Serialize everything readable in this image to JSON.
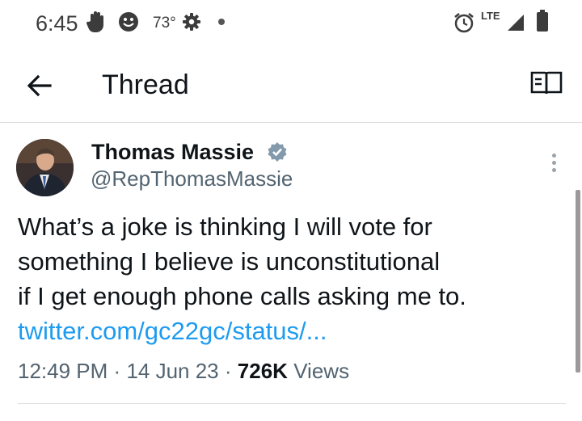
{
  "status_bar": {
    "time": "6:45",
    "temperature": "73°",
    "network": "LTE",
    "icons": [
      "hand-icon",
      "smiley-icon",
      "gear-icon",
      "dot-icon",
      "alarm-icon",
      "signal-icon",
      "battery-icon"
    ]
  },
  "app_bar": {
    "title": "Thread",
    "back_icon": "arrow-left-icon",
    "reader_icon": "book-icon"
  },
  "tweet": {
    "author_name": "Thomas Massie",
    "handle": "@RepThomasMassie",
    "verified": true,
    "text_lines": [
      "What’s a joke is thinking I will vote for",
      "something I believe is unconstitutional",
      "if I get enough phone calls asking me to."
    ],
    "link": "twitter.com/gc22gc/status/...",
    "time": "12:49 PM",
    "separator": "·",
    "date": "14 Jun 23",
    "views_count": "726K",
    "views_label": "Views"
  },
  "colors": {
    "link": "#1d9bf0",
    "secondary_text": "#536471",
    "verified_badge": "#829aab"
  }
}
